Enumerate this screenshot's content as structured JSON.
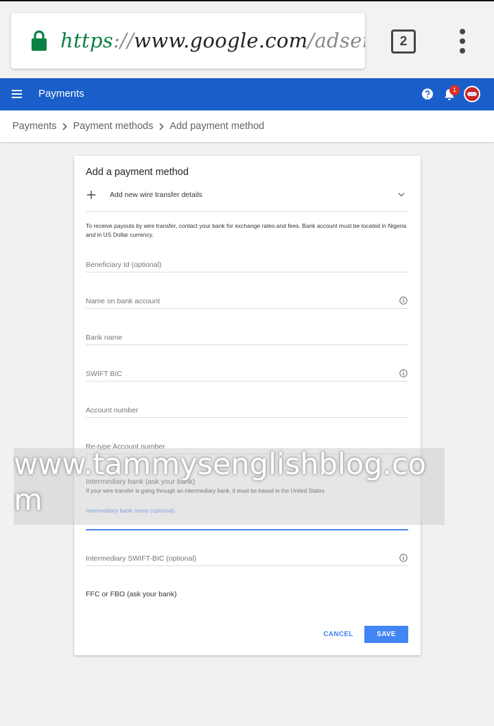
{
  "browser": {
    "url_scheme": "https",
    "url_separator": "://",
    "url_host": "www.google.com",
    "url_path": "/adsense/",
    "tab_count": "2",
    "lock_color": "#0b8043"
  },
  "appbar": {
    "title": "Payments",
    "notification_count": "1",
    "color": "#1a5fc9"
  },
  "breadcrumb": {
    "items": [
      "Payments",
      "Payment methods",
      "Add payment method"
    ]
  },
  "form": {
    "title": "Add a payment method",
    "add_option_label": "Add new wire transfer details",
    "info_text": "To receive payouts by wire transfer, contact your bank for exchange rates and fees. Bank account must be located in Nigeria and in US Dollar currency.",
    "fields": {
      "beneficiary_id": "Beneficiary Id (optional)",
      "name_on_account": "Name on bank account",
      "bank_name": "Bank name",
      "swift_bic": "SWIFT BIC",
      "account_number": "Account number",
      "retype_account_number": "Re-type Account number",
      "intermediary_bank_name": "Intermediary bank name (optional)",
      "intermediary_swift": "Intermediary SWIFT-BIC (optional)"
    },
    "intermediary_heading": "Intermediary bank (ask your bank)",
    "intermediary_subtext": "If your wire transfer is going through an intermediary bank, it must be based in the United States.",
    "ffc_label": "FFC or FBO (ask your bank)",
    "cancel_label": "CANCEL",
    "save_label": "SAVE",
    "accent_color": "#4285f4"
  },
  "watermark": {
    "text": "www.tammysenglishblog.com"
  }
}
